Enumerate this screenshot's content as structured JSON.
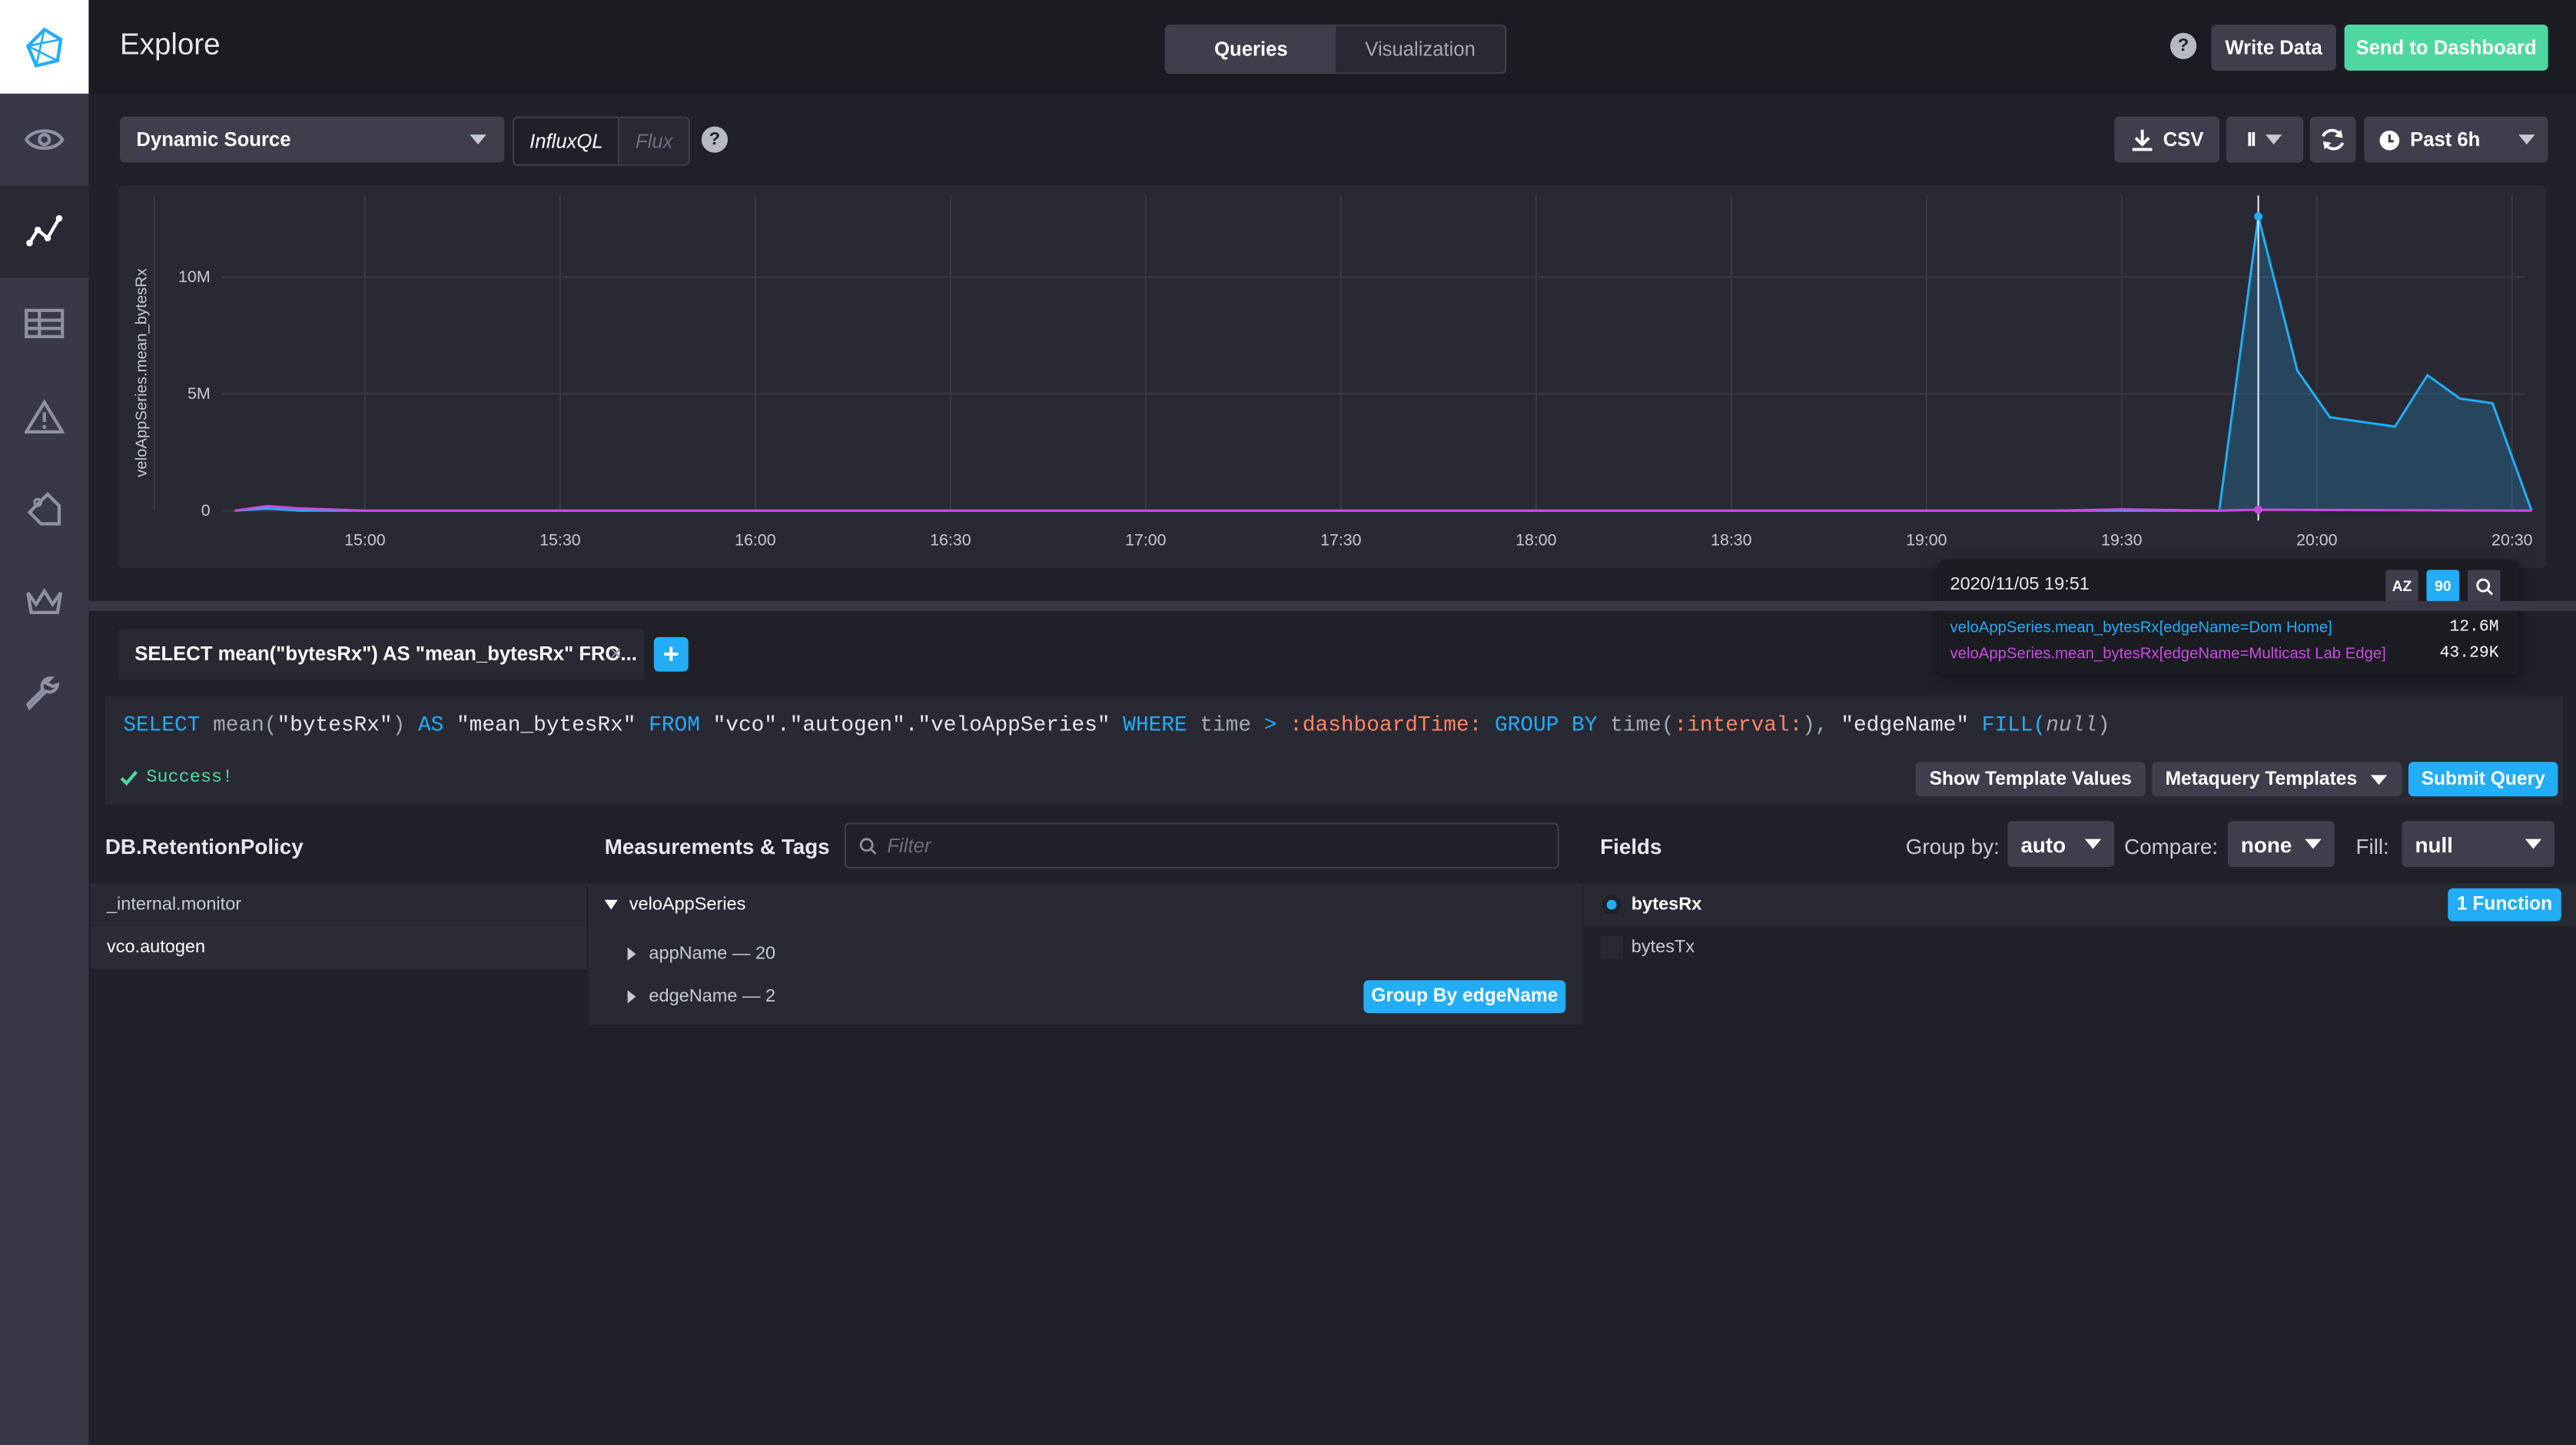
{
  "sidebar": {
    "items": [
      {
        "name": "eye-icon"
      },
      {
        "name": "graph-icon",
        "active": true
      },
      {
        "name": "table-icon"
      },
      {
        "name": "alert-icon"
      },
      {
        "name": "tag-icon"
      },
      {
        "name": "crown-icon"
      },
      {
        "name": "wrench-icon"
      }
    ]
  },
  "header": {
    "title": "Explore",
    "tabs": [
      "Queries",
      "Visualization"
    ],
    "active_tab": "Queries",
    "help": "?",
    "write_data": "Write Data",
    "send_to_dashboard": "Send to Dashboard"
  },
  "toolbar": {
    "source": "Dynamic Source",
    "lang_influxql": "InfluxQL",
    "lang_flux": "Flux",
    "help": "?",
    "csv": "CSV",
    "pause": "II",
    "time_range": "Past 6h"
  },
  "chart_data": {
    "type": "area",
    "ylabel": "veloAppSeries.mean_bytesRx",
    "y_ticks": [
      "10M",
      "5M",
      "0"
    ],
    "y_tick_values": [
      10000000,
      5000000,
      0
    ],
    "x_ticks": [
      "15:00",
      "15:30",
      "16:00",
      "16:30",
      "17:00",
      "17:30",
      "18:00",
      "18:30",
      "19:00",
      "19:30",
      "20:00",
      "20:30"
    ],
    "ylim": [
      0,
      13500000
    ],
    "series": [
      {
        "name": "veloAppSeries.mean_bytesRx[edgeName=Dom Home]",
        "color": "#22adf6",
        "x": [
          "14:40",
          "14:45",
          "14:50",
          "15:00",
          "19:20",
          "19:30",
          "19:45",
          "19:51",
          "19:57",
          "20:02",
          "20:12",
          "20:17",
          "20:22",
          "20:27",
          "20:33"
        ],
        "values": [
          0,
          100000,
          0,
          0,
          0,
          0,
          0,
          12600000,
          6000000,
          4000000,
          3600000,
          5800000,
          4800000,
          4600000,
          0
        ]
      },
      {
        "name": "veloAppSeries.mean_bytesRx[edgeName=Multicast Lab Edge]",
        "color": "#c94de0",
        "x": [
          "14:40",
          "14:45",
          "14:50",
          "15:00",
          "19:20",
          "19:30",
          "19:45",
          "19:51",
          "20:33"
        ],
        "values": [
          0,
          200000,
          100000,
          0,
          0,
          60000,
          0,
          43290,
          0
        ]
      }
    ],
    "cursor_x": "19:51",
    "grid": true
  },
  "tooltip": {
    "timestamp": "2020/11/05 19:51",
    "sort_az": "AZ",
    "sort_90": "90",
    "rows": [
      {
        "label": "veloAppSeries.mean_bytesRx[edgeName=Dom Home]",
        "value": "12.6M",
        "color": "#22adf6"
      },
      {
        "label": "veloAppSeries.mean_bytesRx[edgeName=Multicast Lab Edge]",
        "value": "43.29K",
        "color": "#c94de0"
      }
    ]
  },
  "query_tab": {
    "label": "SELECT mean(\"bytesRx\") AS \"mean_bytesRx\" FRO...",
    "close": "×",
    "add": "+"
  },
  "editor": {
    "query_parts": {
      "select": "SELECT",
      "mean": " mean(",
      "bytesRx": "\"bytesRx\"",
      "paren": ") ",
      "as": "AS",
      "alias": " \"mean_bytesRx\" ",
      "from": "FROM",
      "source": " \"vco\".\"autogen\".\"veloAppSeries\" ",
      "where": "WHERE",
      "time": " time ",
      "gt": ">",
      "dash_time": " :dashboardTime: ",
      "group_by": "GROUP BY",
      "time_fn": " time(",
      "interval": ":interval:",
      "close_comma": "), ",
      "edge": "\"edgeName\" ",
      "fill": "FILL(",
      "null": "null",
      "close": ")"
    },
    "status": "Success!",
    "show_template_values": "Show Template Values",
    "metaquery_templates": "Metaquery Templates",
    "submit_query": "Submit Query"
  },
  "builder": {
    "db_header": "DB.RetentionPolicy",
    "dbs": [
      "_internal.monitor",
      "vco.autogen"
    ],
    "selected_db": "vco.autogen",
    "measurements_header": "Measurements & Tags",
    "filter_placeholder": "Filter",
    "measurement": "veloAppSeries",
    "tags": [
      "appName — 20",
      "edgeName — 2"
    ],
    "group_by_edge": "Group By edgeName",
    "fields_header": "Fields",
    "group_by_label": "Group by:",
    "group_by_value": "auto",
    "compare_label": "Compare:",
    "compare_value": "none",
    "fill_label": "Fill:",
    "fill_value": "null",
    "fields": [
      "bytesRx",
      "bytesTx"
    ],
    "function_badge": "1 Function"
  }
}
